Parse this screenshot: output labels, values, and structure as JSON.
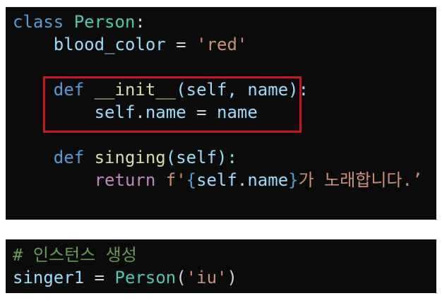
{
  "block1": {
    "line1": {
      "kw": "class",
      "name": "Person",
      "colon": ":"
    },
    "line2": {
      "var": "blood_color",
      "op": " = ",
      "str": "'red'"
    },
    "line3": {
      "kw": "def",
      "fn": "__init__",
      "args": "(self, name):"
    },
    "line4": {
      "self": "self",
      "dot": ".",
      "attr": "name",
      "op": " = ",
      "val": "name"
    },
    "line5": {
      "kw": "def",
      "fn": "singing",
      "args": "(self):"
    },
    "line6": {
      "ret": "return",
      "fprefix": "f'",
      "brace_open": "{",
      "self": "self",
      "dot": ".",
      "attr": "name",
      "brace_close": "}",
      "rest": "가 노래합니다.’"
    }
  },
  "block2": {
    "comment": "# 인스턴스 생성",
    "line": {
      "var": "singer1",
      "op": " = ",
      "cls": "Person",
      "open": "(",
      "str": "'iu'",
      "close": ")"
    }
  },
  "colors": {
    "background": "#0b0b0b",
    "highlight_border": "#c8181e"
  }
}
